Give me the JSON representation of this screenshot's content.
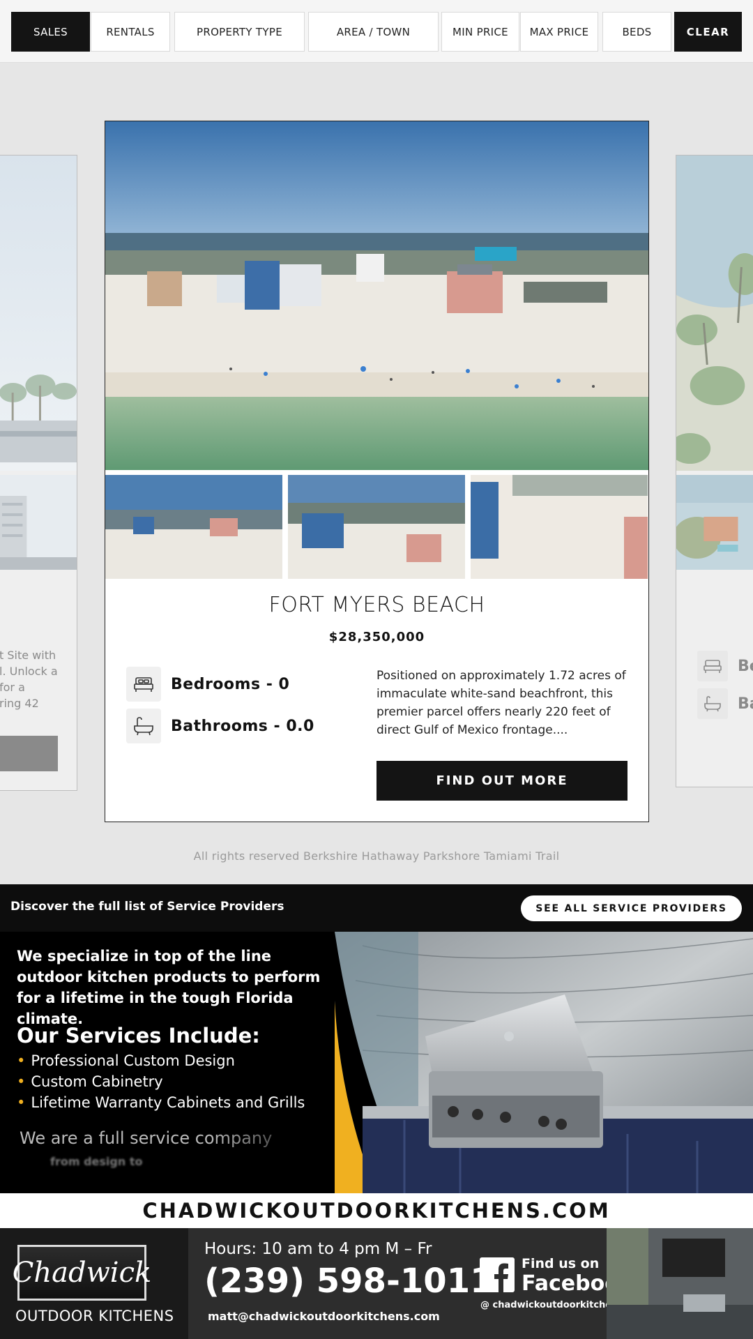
{
  "filters": {
    "sales": "SALES",
    "rentals": "RENTALS",
    "property_type": "PROPERTY TYPE",
    "area_town": "AREA / TOWN",
    "min_price": "MIN PRICE",
    "max_price": "MAX PRICE",
    "beds": "BEDS",
    "clear": "CLEAR"
  },
  "left_card": {
    "desc_lines": [
      "t Site with",
      "l. Unlock a",
      " for a",
      "ring 42"
    ]
  },
  "right_card": {
    "bed_label": "Be",
    "bath_label": "Ba"
  },
  "listing": {
    "title": "FORT MYERS BEACH",
    "price": "$28,350,000",
    "bedrooms": "Bedrooms - 0",
    "bathrooms": "Bathrooms - 0.0",
    "description": "Positioned on approximately 1.72 acres of immaculate white-sand beachfront, this premier parcel offers nearly 220 feet of direct Gulf of Mexico frontage....",
    "cta": "FIND OUT MORE"
  },
  "footer_rights": "All rights reserved Berkshire Hathaway Parkshore Tamiami Trail",
  "service_providers": {
    "text": "Discover the full list of Service Providers",
    "button": "SEE ALL SERVICE PROVIDERS"
  },
  "ad": {
    "lead": "We specialize in top of the line outdoor kitchen products to perform for a lifetime in the tough Florida climate.",
    "services_heading": "Our Services Include:",
    "services": [
      "Professional Custom Design",
      "Custom Cabinetry",
      "Lifetime Warranty Cabinets and Grills"
    ],
    "tagline": "We are a full service company",
    "tagline_2": "from design to",
    "website": "CHADWICKOUTDOORKITCHENS.COM",
    "logo_script": "Chadwick",
    "logo_sub": "OUTDOOR KITCHENS",
    "hours": "Hours: 10 am to 4 pm M – Fr",
    "phone": "(239) 598-1011",
    "email": "matt@chadwickoutdoorkitchens.com",
    "fb_find": "Find us on",
    "fb_name": "Facebook",
    "fb_handle": "@ chadwickoutdoorkitchens"
  },
  "colors": {
    "dark": "#141414",
    "accent_yellow": "#f0b020",
    "muted_text": "#9a9a9a"
  }
}
